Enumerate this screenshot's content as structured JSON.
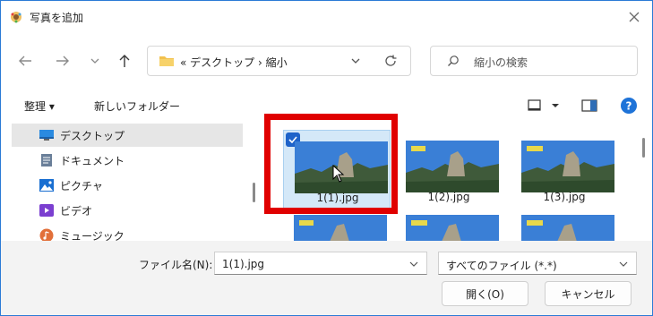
{
  "window": {
    "title": "写真を追加"
  },
  "nav": {
    "address_path": "« デスクトップ › 縮小",
    "search_placeholder": "縮小の検索"
  },
  "commandbar": {
    "organize": "整理 ▾",
    "new_folder": "新しいフォルダー"
  },
  "sidebar": {
    "items": [
      {
        "label": "デスクトップ",
        "icon": "desktop-icon",
        "selected": true
      },
      {
        "label": "ドキュメント",
        "icon": "documents-icon"
      },
      {
        "label": "ピクチャ",
        "icon": "pictures-icon"
      },
      {
        "label": "ビデオ",
        "icon": "videos-icon"
      },
      {
        "label": "ミュージック",
        "icon": "music-icon"
      }
    ]
  },
  "files": [
    {
      "name": "1(1).jpg",
      "selected": true
    },
    {
      "name": "1(2).jpg"
    },
    {
      "name": "1(3).jpg"
    }
  ],
  "footer": {
    "filename_label": "ファイル名(N):",
    "filename_value": "1(1).jpg",
    "filetype_value": "すべてのファイル (*.*)",
    "open_button": "開く(O)",
    "cancel_button": "キャンセル"
  },
  "colors": {
    "accent": "#1e63c9",
    "highlight": "#e00000",
    "help": "#1e73d8"
  }
}
